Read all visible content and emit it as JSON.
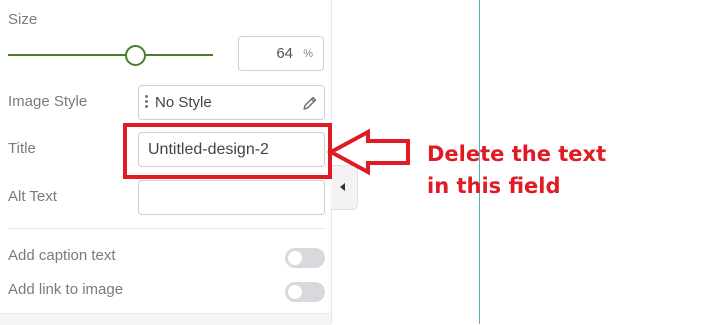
{
  "panel": {
    "size": {
      "label": "Size",
      "slider_fraction": 0.64,
      "value": "64",
      "unit": "%"
    },
    "image_style": {
      "label": "Image Style",
      "value": "No Style",
      "icon": "pencil-icon"
    },
    "title": {
      "label": "Title",
      "value": "Untitled-design-2"
    },
    "alt_text": {
      "label": "Alt Text",
      "value": ""
    },
    "toggles": [
      {
        "label": "Add caption text",
        "on": false
      },
      {
        "label": "Add link to image",
        "on": false
      }
    ]
  },
  "annotation": {
    "line1": "Delete the text",
    "line2": "in this field",
    "color": "#e01b24"
  },
  "colors": {
    "slider_accent": "#4a7d2e",
    "canvas_guide": "#4fb3b5",
    "toggle_off": "#d7d9dc"
  }
}
